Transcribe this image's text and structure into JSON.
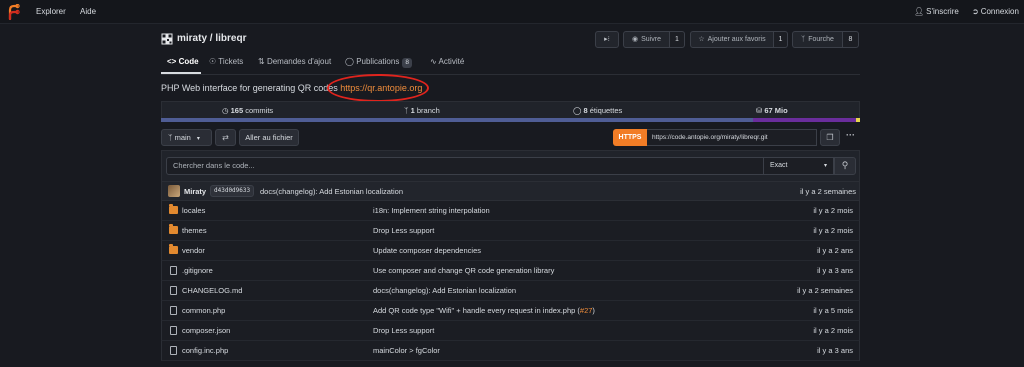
{
  "topnav": {
    "explore": "Explorer",
    "help": "Aide",
    "signup": "S'inscrire",
    "login": "Connexion"
  },
  "repo": {
    "title": "miraty / libreqr",
    "rss_icon": "rss-icon",
    "watch_label": "Suivre",
    "watch_count": "1",
    "star_label": "Ajouter aux favoris",
    "star_count": "1",
    "fork_label": "Fourche",
    "fork_count": "8"
  },
  "tabs": {
    "code": "Code",
    "issues": "Tickets",
    "pulls": "Demandes d'ajout",
    "releases": "Publications",
    "releases_count": "8",
    "activity": "Activité"
  },
  "description": {
    "text": "PHP Web interface for generating QR codes",
    "link": "https://qr.antopie.org"
  },
  "stats": {
    "commits_n": "165",
    "commits_label": " commits",
    "branch_n": "1",
    "branch_label": " branch",
    "tags_n": "8",
    "tags_label": " étiquettes",
    "size": "67 Mio"
  },
  "languages": {
    "colors": [
      "#4f5d95",
      "#6a2d9c",
      "#e7d64f"
    ]
  },
  "toolbar": {
    "branch": "main",
    "go_to_file": "Aller au fichier",
    "https": "HTTPS",
    "clone_url": "https://code.antopie.org/miraty/libreqr.git"
  },
  "search": {
    "placeholder": "Chercher dans le code...",
    "mode": "Exact"
  },
  "last_commit": {
    "author": "Miraty",
    "sha": "d43d0d9633",
    "message": "docs(changelog): Add Estonian localization",
    "time": "il y a 2 semaines"
  },
  "files": [
    {
      "name": "locales",
      "type": "folder",
      "message": "i18n: Implement string interpolation",
      "time": "il y a 2 mois"
    },
    {
      "name": "themes",
      "type": "folder",
      "message": "Drop Less support",
      "time": "il y a 2 mois"
    },
    {
      "name": "vendor",
      "type": "folder",
      "message": "Update composer dependencies",
      "time": "il y a 2 ans"
    },
    {
      "name": ".gitignore",
      "type": "file",
      "message": "Use composer and change QR code generation library",
      "time": "il y a 3 ans"
    },
    {
      "name": "CHANGELOG.md",
      "type": "file",
      "message": "docs(changelog): Add Estonian localization",
      "time": "il y a 2 semaines"
    },
    {
      "name": "common.php",
      "type": "file",
      "message": "Add QR code type \"Wifi\" + handle every request in index.php (",
      "ref": "#27",
      "message_end": ")",
      "time": "il y a 5 mois"
    },
    {
      "name": "composer.json",
      "type": "file",
      "message": "Drop Less support",
      "time": "il y a 2 mois"
    },
    {
      "name": "config.inc.php",
      "type": "file",
      "message": "mainColor > fgColor",
      "time": "il y a 3 ans"
    }
  ]
}
